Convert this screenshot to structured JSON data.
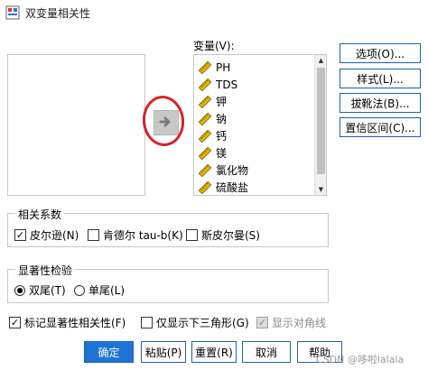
{
  "window": {
    "title": "双变量相关性"
  },
  "variables": {
    "label": "变量(V):",
    "items": [
      {
        "label": "PH",
        "icon": "ruler-icon"
      },
      {
        "label": "TDS",
        "icon": "ruler-icon"
      },
      {
        "label": "钾",
        "icon": "ruler-icon"
      },
      {
        "label": "钠",
        "icon": "ruler-icon"
      },
      {
        "label": "钙",
        "icon": "ruler-icon"
      },
      {
        "label": "镁",
        "icon": "ruler-icon"
      },
      {
        "label": "氯化物",
        "icon": "ruler-icon"
      },
      {
        "label": "硫酸盐",
        "icon": "ruler-icon"
      }
    ]
  },
  "side_buttons": {
    "options": "选项(O)...",
    "style": "样式(L)...",
    "bootstrap": "拔靴法(B)...",
    "ci": "置信区间(C)..."
  },
  "correlation": {
    "title": "相关系数",
    "pearson": "皮尔逊(N)",
    "kendall": "肯德尔 tau-b(K)",
    "spearman": "斯皮尔曼(S)"
  },
  "significance": {
    "title": "显著性检验",
    "two_tailed": "双尾(T)",
    "one_tailed": "单尾(L)"
  },
  "flags": {
    "flag_significant": "标记显著性相关性(F)",
    "lower_triangle": "仅显示下三角形(G)",
    "show_diagonal": "显示对角线"
  },
  "buttons": {
    "ok": "确定",
    "paste": "粘贴(P)",
    "reset": "重置(R)",
    "cancel": "取消",
    "help": "帮助"
  },
  "watermark": "CSDN @哆啦lalala",
  "colors": {
    "accent": "#1e74d6",
    "annotation": "#d5242a",
    "ruler": "#d4a400"
  }
}
